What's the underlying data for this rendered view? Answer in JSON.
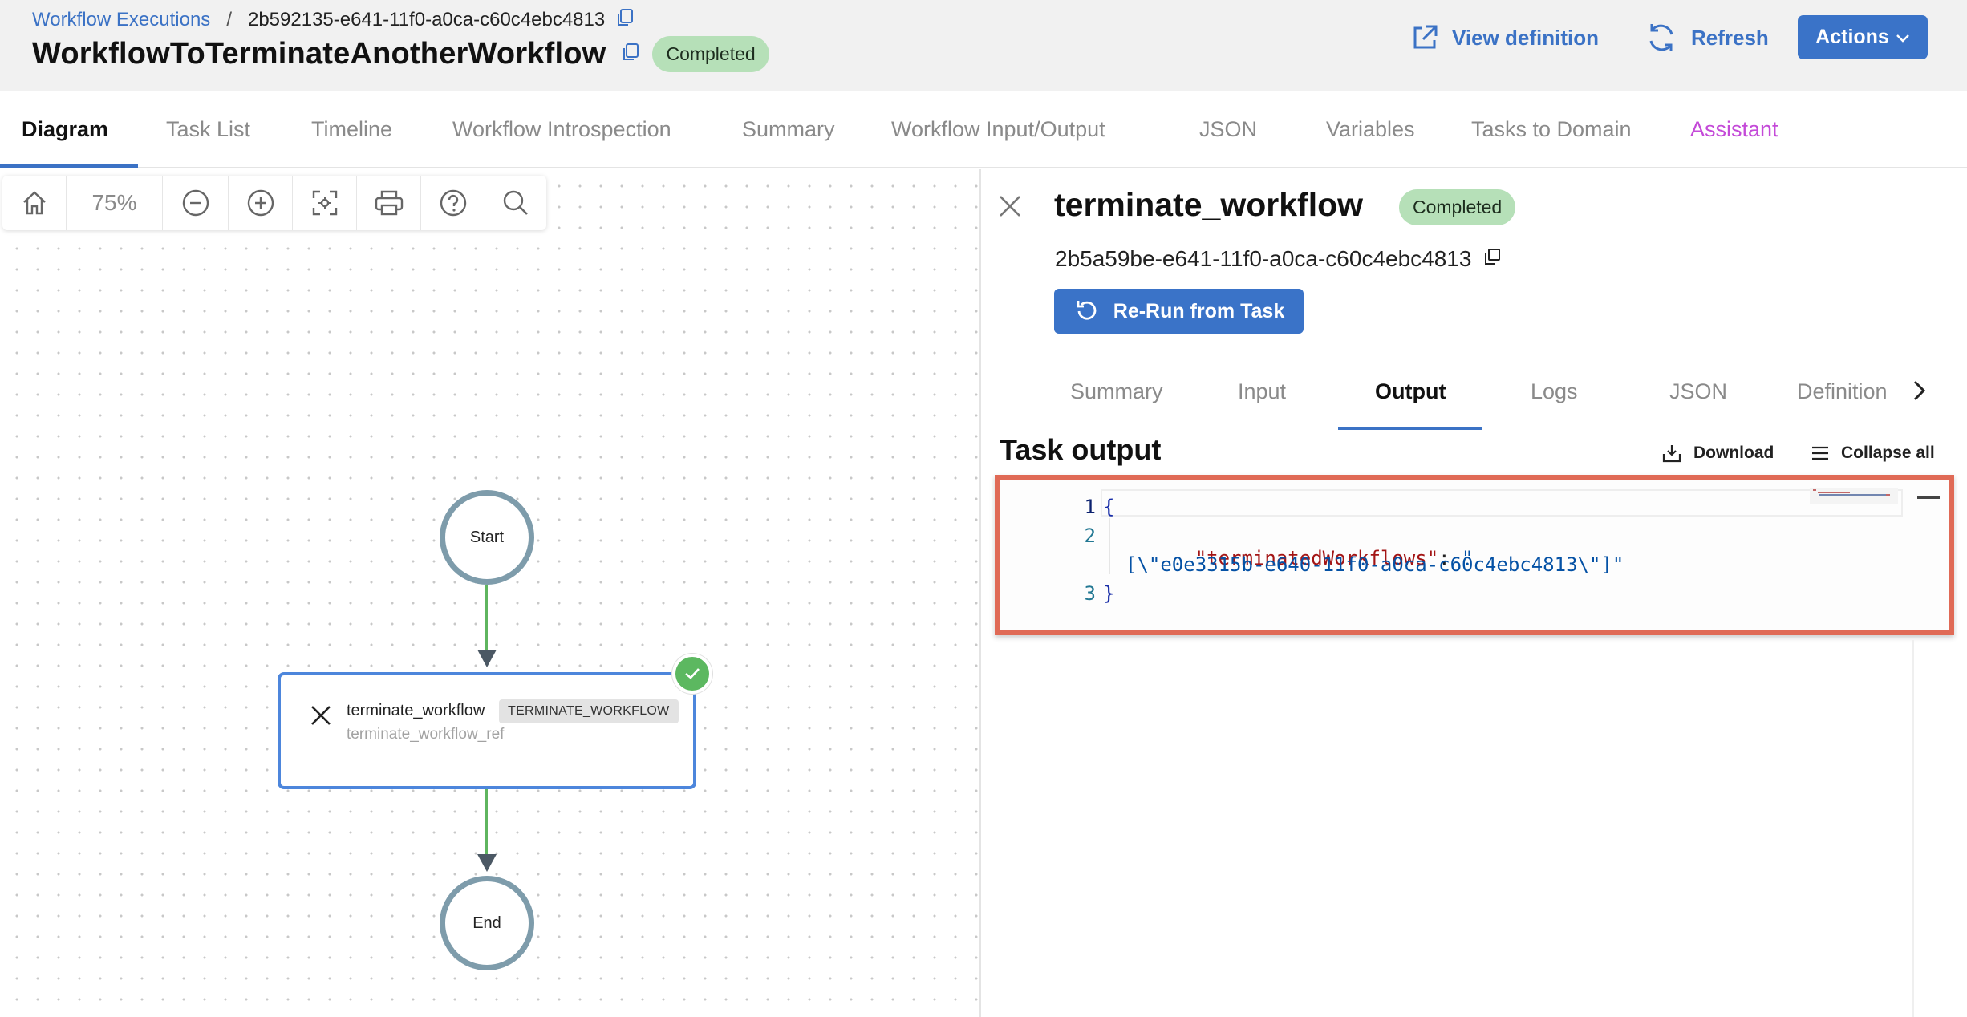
{
  "breadcrumb": {
    "root": "Workflow Executions",
    "separator": "/",
    "execution_id": "2b592135-e641-11f0-a0ca-c60c4ebc4813"
  },
  "header": {
    "title": "WorkflowToTerminateAnotherWorkflow",
    "status": "Completed",
    "view_definition": "View definition",
    "refresh": "Refresh",
    "actions": "Actions"
  },
  "tabs": [
    {
      "label": "Diagram",
      "active": true
    },
    {
      "label": "Task List"
    },
    {
      "label": "Timeline"
    },
    {
      "label": "Workflow Introspection"
    },
    {
      "label": "Summary"
    },
    {
      "label": "Workflow Input/Output"
    },
    {
      "label": "JSON"
    },
    {
      "label": "Variables"
    },
    {
      "label": "Tasks to Domain"
    },
    {
      "label": "Assistant"
    }
  ],
  "toolbar": {
    "zoom": "75%",
    "icons": [
      "home-icon",
      "zoom-out-icon",
      "zoom-in-icon",
      "fit-view-icon",
      "print-icon",
      "help-icon",
      "search-icon"
    ]
  },
  "diagram": {
    "start_label": "Start",
    "end_label": "End",
    "task": {
      "name": "terminate_workflow",
      "type": "TERMINATE_WORKFLOW",
      "ref": "terminate_workflow_ref",
      "status": "completed"
    }
  },
  "panel": {
    "title": "terminate_workflow",
    "status": "Completed",
    "task_id": "2b5a59be-e641-11f0-a0ca-c60c4ebc4813",
    "rerun": "Re-Run from Task",
    "tabs": [
      {
        "label": "Summary"
      },
      {
        "label": "Input"
      },
      {
        "label": "Output",
        "active": true
      },
      {
        "label": "Logs"
      },
      {
        "label": "JSON"
      },
      {
        "label": "Definition"
      }
    ],
    "section_title": "Task output",
    "download": "Download",
    "collapse_all": "Collapse all",
    "code": {
      "line_numbers": [
        "1",
        "2",
        "3"
      ],
      "open_brace": "{",
      "key": "\"terminatedWorkflows\"",
      "colon": ": ",
      "value_part1": "\"",
      "value_part2": "[\\\"e0e3315b-e640-11f0-a0ca-c60c4ebc4813\\\"]\"",
      "close_brace": "}"
    }
  },
  "colors": {
    "accent": "#3a73c8",
    "badge": "#b6e0b8",
    "assistant": "#c44ad8",
    "success": "#5cb860",
    "node_border": "#7e9cab",
    "highlight": "#e06a56"
  }
}
